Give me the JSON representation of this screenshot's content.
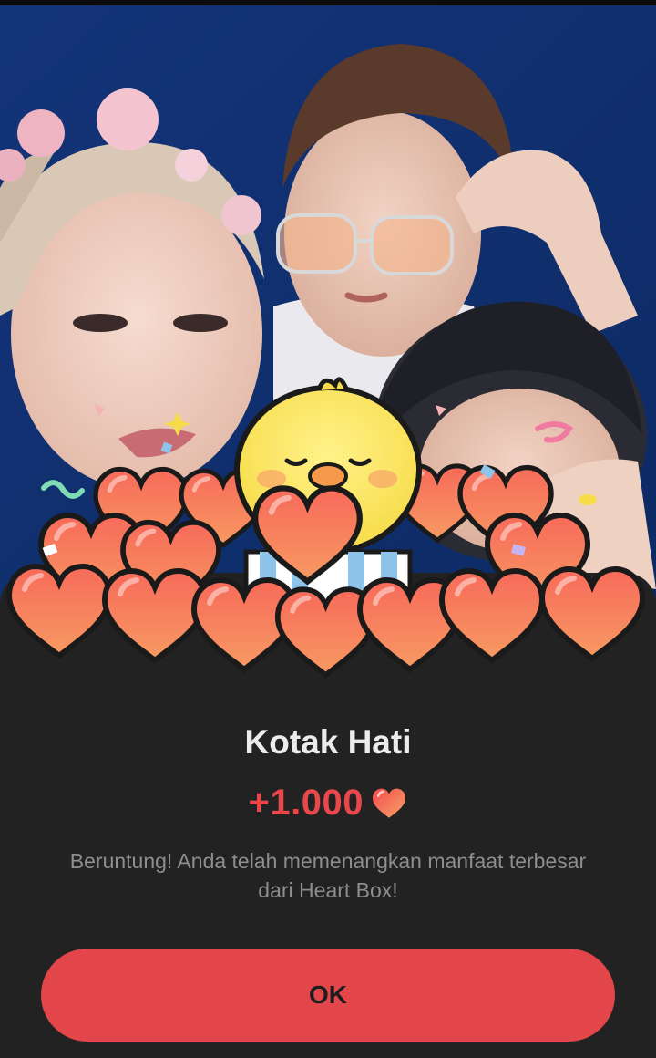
{
  "dialog": {
    "title": "Kotak Hati",
    "amount": "+1.000",
    "message": "Beruntung! Anda telah memenangkan manfaat terbesar dari Heart Box!",
    "ok_label": "OK"
  },
  "colors": {
    "sheet_bg": "#222222",
    "accent": "#e2464a",
    "amount_text": "#e8484a",
    "title_text": "#ececec",
    "message_text": "#8e8e8e",
    "photo_bg": "#0f2f6e"
  },
  "icons": [
    "heart-icon",
    "chick-mascot-icon",
    "confetti-icon"
  ]
}
